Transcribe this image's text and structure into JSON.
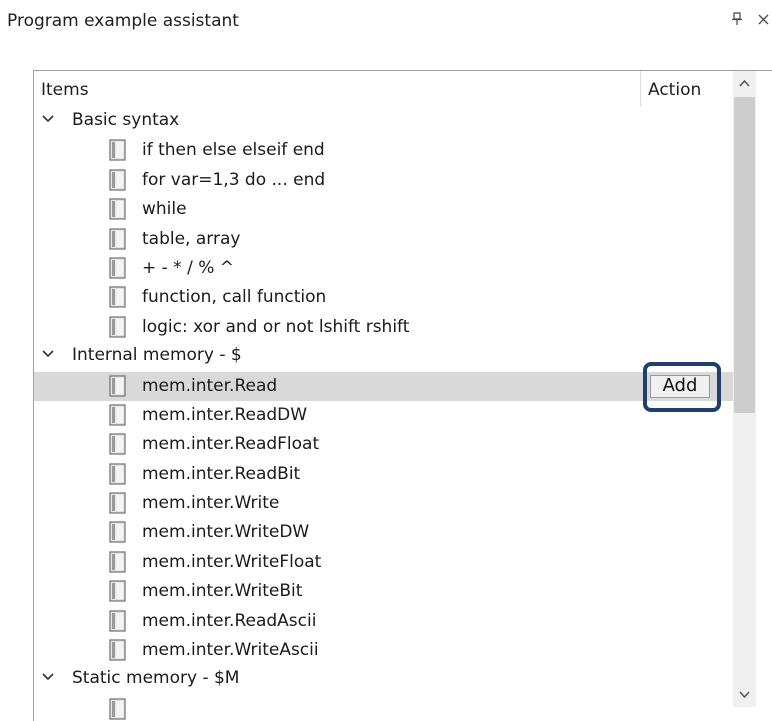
{
  "panel": {
    "title": "Program example assistant",
    "pin_icon": "pin-icon",
    "close_icon": "close-icon"
  },
  "columns": {
    "items": "Items",
    "action": "Action"
  },
  "tree": [
    {
      "kind": "category",
      "label": "Basic syntax",
      "expanded": true
    },
    {
      "kind": "item",
      "label": "if then else elseif end"
    },
    {
      "kind": "item",
      "label": "for var=1,3 do ... end"
    },
    {
      "kind": "item",
      "label": "while"
    },
    {
      "kind": "item",
      "label": "table, array"
    },
    {
      "kind": "item",
      "label": "+ - * / % ^"
    },
    {
      "kind": "item",
      "label": "function, call function"
    },
    {
      "kind": "item",
      "label": "logic: xor and or not lshift rshift"
    },
    {
      "kind": "category",
      "label": "Internal memory - $",
      "expanded": true
    },
    {
      "kind": "item",
      "label": "mem.inter.Read",
      "selected": true,
      "action": "Add"
    },
    {
      "kind": "item",
      "label": "mem.inter.ReadDW"
    },
    {
      "kind": "item",
      "label": "mem.inter.ReadFloat"
    },
    {
      "kind": "item",
      "label": "mem.inter.ReadBit"
    },
    {
      "kind": "item",
      "label": "mem.inter.Write"
    },
    {
      "kind": "item",
      "label": "mem.inter.WriteDW"
    },
    {
      "kind": "item",
      "label": "mem.inter.WriteFloat"
    },
    {
      "kind": "item",
      "label": "mem.inter.WriteBit"
    },
    {
      "kind": "item",
      "label": "mem.inter.ReadAscii"
    },
    {
      "kind": "item",
      "label": "mem.inter.WriteAscii"
    },
    {
      "kind": "category",
      "label": "Static memory - $M",
      "expanded": true
    },
    {
      "kind": "item",
      "label": ""
    }
  ],
  "colors": {
    "selection": "#d9d9d9",
    "highlight_border": "#1f3f6e",
    "scrollbar_track": "#f0f0f0",
    "scrollbar_thumb": "#cdcdcd"
  }
}
